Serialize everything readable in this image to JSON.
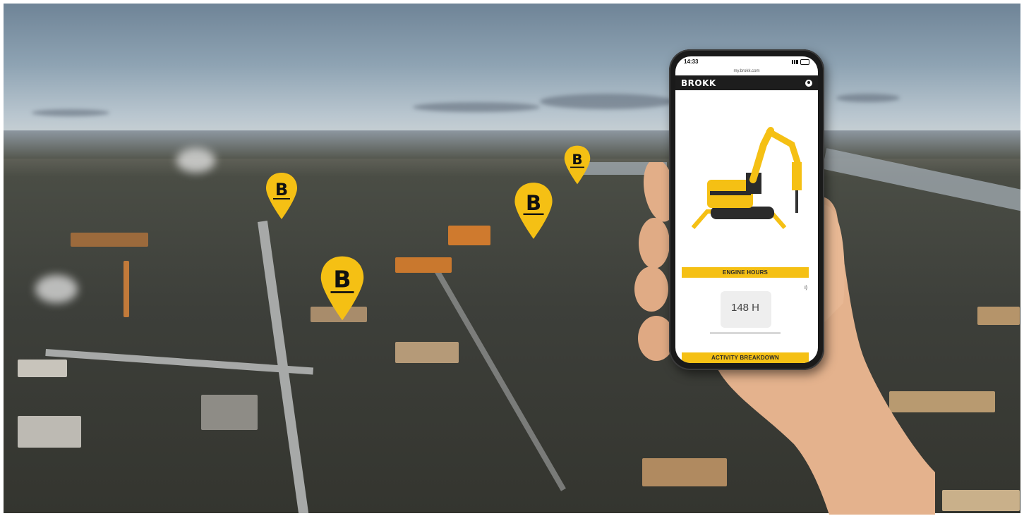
{
  "phone": {
    "status_time": "14:33",
    "url": "my.brokk.com",
    "brand": "BROKK",
    "engine_hours_title": "ENGINE HOURS",
    "engine_hours_value": "148 H",
    "activity_title": "ACTIVITY BREAKDOWN",
    "corner_mark": "i)"
  },
  "map_pins": [
    {
      "label": "B"
    },
    {
      "label": "B"
    },
    {
      "label": "B"
    },
    {
      "label": "B"
    }
  ],
  "colors": {
    "brand_yellow": "#f5c014",
    "appbar_dark": "#1d1d1d"
  }
}
